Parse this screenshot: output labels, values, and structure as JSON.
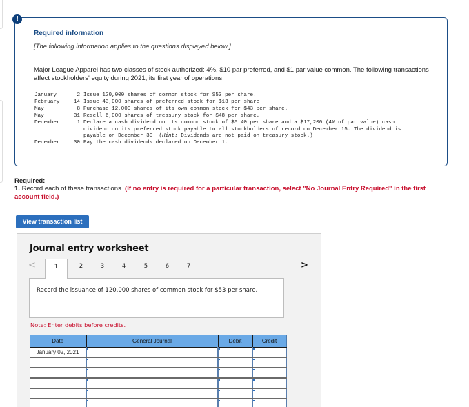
{
  "alert": {
    "icon": "exclamation-icon",
    "glyph": "!"
  },
  "required_information": {
    "title": "Required information",
    "subtitle": "[The following information applies to the questions displayed below.]",
    "intro": "Major League Apparel has two classes of stock authorized: 4%, $10 par preferred, and $1 par value common. The following transactions affect stockholders' equity during 2021, its first year of operations:",
    "transactions": [
      {
        "month": "January",
        "day": "2",
        "description": "Issue 120,000 shares of common stock for $53 per share."
      },
      {
        "month": "February",
        "day": "14",
        "description": "Issue 43,000 shares of preferred stock for $13 per share."
      },
      {
        "month": "May",
        "day": "8",
        "description": "Purchase 12,000 shares of its own common stock for $43 per share."
      },
      {
        "month": "May",
        "day": "31",
        "description": "Resell 6,000 shares of treasury stock for $48 per share."
      },
      {
        "month": "December",
        "day": "1",
        "description_main": "Declare a cash dividend on its common stock of $0.40 per share and a $17,200 (4% of par value) cash dividend on its preferred stock payable to all stockholders of record on December 15. The dividend is payable on December 30. (",
        "hint_label": "Hint:",
        "description_tail": " Dividends are not paid on treasury stock.)"
      },
      {
        "month": "December",
        "day": "30",
        "description": "Pay the cash dividends declared on December 1."
      }
    ]
  },
  "required": {
    "label": "Required:",
    "number": "1.",
    "instruction": "Record each of these transactions.",
    "warning": "(If no entry is required for a particular transaction, select \"No Journal Entry Required\" in the first account field.)"
  },
  "view_transaction_list_button": "View transaction list",
  "worksheet": {
    "title": "Journal entry worksheet",
    "prev_icon": "<",
    "next_icon": ">",
    "tabs": [
      "1",
      "2",
      "3",
      "4",
      "5",
      "6",
      "7"
    ],
    "active_tab": "1",
    "prompt": "Record the issuance of 120,000 shares of common stock for $53 per share.",
    "note": "Note: Enter debits before credits.",
    "table": {
      "headers": {
        "date": "Date",
        "general_journal": "General Journal",
        "debit": "Debit",
        "credit": "Credit"
      },
      "rows": [
        {
          "date": "January 02, 2021",
          "account": "",
          "debit": "",
          "credit": ""
        },
        {
          "date": "",
          "account": "",
          "debit": "",
          "credit": ""
        },
        {
          "date": "",
          "account": "",
          "debit": "",
          "credit": ""
        },
        {
          "date": "",
          "account": "",
          "debit": "",
          "credit": ""
        },
        {
          "date": "",
          "account": "",
          "debit": "",
          "credit": ""
        },
        {
          "date": "",
          "account": "",
          "debit": "",
          "credit": ""
        }
      ]
    }
  },
  "colors": {
    "brand_blue": "#1b4d86",
    "button_blue": "#2c6fbd",
    "warning_red": "#c8102e",
    "table_header": "#6aa9e6"
  }
}
